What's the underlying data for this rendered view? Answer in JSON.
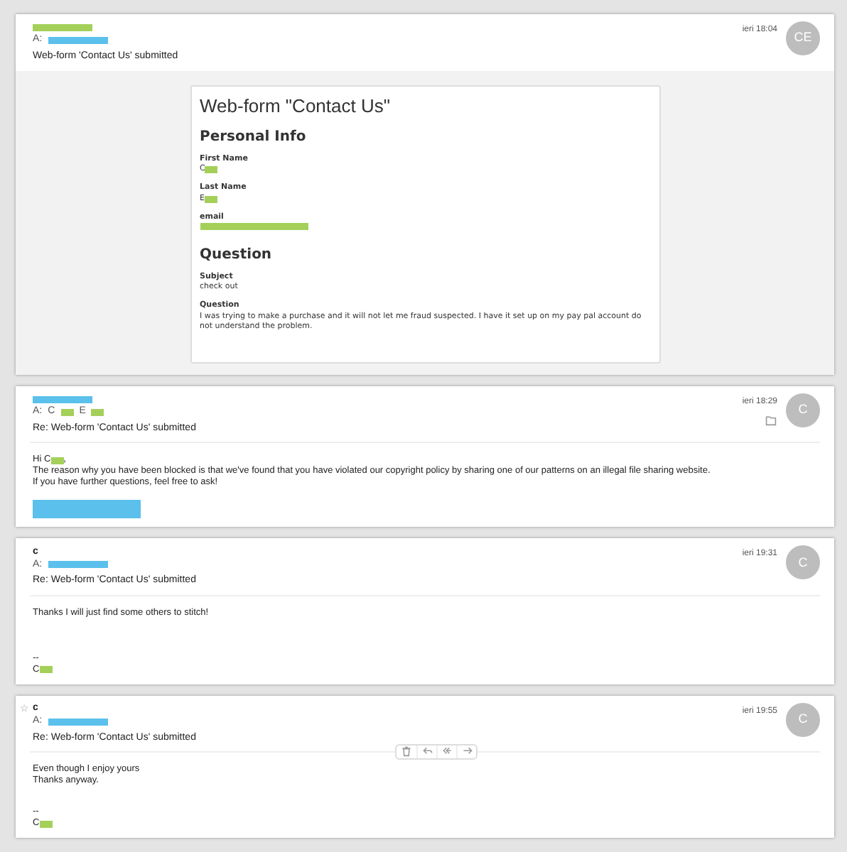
{
  "messages": [
    {
      "sender": [
        {
          "kind": "redaction",
          "color": "#a4d05a"
        }
      ],
      "to": [
        {
          "kind": "text",
          "text": "A:"
        },
        {
          "kind": "redaction",
          "color": "#5bc0eb"
        }
      ],
      "subject": "Web-form 'Contact Us' submitted",
      "time": "ieri 18:04",
      "avatar": "CE",
      "folder": false,
      "toolbar": false,
      "body": {
        "kind": "form",
        "title": "Web-form \"Contact Us\"",
        "sections": [
          {
            "heading": "Personal Info",
            "fields": [
              {
                "label": "First Name",
                "value": [
                  {
                    "kind": "text",
                    "text": "C"
                  },
                  {
                    "kind": "redaction",
                    "color": "#a4d05a"
                  }
                ]
              },
              {
                "label": "Last Name",
                "value": [
                  {
                    "kind": "text",
                    "text": "E"
                  },
                  {
                    "kind": "redaction",
                    "color": "#a4d05a"
                  }
                ]
              },
              {
                "label": "email",
                "value": [
                  {
                    "kind": "redaction",
                    "color": "#a4d05a"
                  }
                ]
              }
            ]
          },
          {
            "heading": "Question",
            "fields": [
              {
                "label": "Subject",
                "value": [
                  {
                    "kind": "text",
                    "text": "check out"
                  }
                ]
              },
              {
                "label": "Question",
                "value": [
                  {
                    "kind": "text",
                    "text": "I was trying to make a purchase and it will not let me fraud suspected. I have it set up on my pay pal account do not understand the problem."
                  }
                ]
              }
            ]
          }
        ]
      }
    },
    {
      "sender": [
        {
          "kind": "redaction",
          "color": "#5bc0eb"
        }
      ],
      "to": [
        {
          "kind": "text",
          "text": "A:"
        },
        {
          "kind": "text",
          "text": "C"
        },
        {
          "kind": "redaction",
          "color": "#a4d05a"
        },
        {
          "kind": "text",
          "text": "E"
        },
        {
          "kind": "redaction",
          "color": "#a4d05a"
        }
      ],
      "subject": "Re: Web-form 'Contact Us' submitted",
      "time": "ieri 18:29",
      "avatar": "C",
      "folder": true,
      "toolbar": false,
      "body": {
        "kind": "text",
        "lines": [
          [
            {
              "kind": "text",
              "text": "Hi C"
            },
            {
              "kind": "redaction",
              "color": "#a4d05a"
            },
            {
              "kind": "text",
              "text": ","
            }
          ],
          [
            {
              "kind": "text",
              "text": "The reason why you have been blocked is that we've found that you have violated our copyright policy by sharing one of our patterns on an illegal file sharing website."
            }
          ],
          [
            {
              "kind": "text",
              "text": "If you have further questions, feel free to ask!"
            }
          ]
        ],
        "signature": [
          [
            {
              "kind": "redaction",
              "color": "#5bc0eb"
            }
          ]
        ]
      }
    },
    {
      "sender": [
        {
          "kind": "text",
          "text": "c"
        }
      ],
      "to": [
        {
          "kind": "text",
          "text": "A:"
        },
        {
          "kind": "redaction",
          "color": "#5bc0eb"
        }
      ],
      "subject": "Re: Web-form 'Contact Us' submitted",
      "time": "ieri 19:31",
      "avatar": "C",
      "folder": false,
      "toolbar": false,
      "body": {
        "kind": "text",
        "lines": [
          [
            {
              "kind": "text",
              "text": "Thanks I will just find some others to stitch!"
            }
          ]
        ],
        "signature": [
          [
            {
              "kind": "text",
              "text": "--"
            }
          ],
          [
            {
              "kind": "text",
              "text": "C"
            },
            {
              "kind": "redaction",
              "color": "#a4d05a"
            }
          ]
        ]
      }
    },
    {
      "star": "☆",
      "sender": [
        {
          "kind": "text",
          "text": "c"
        }
      ],
      "to": [
        {
          "kind": "text",
          "text": "A:"
        },
        {
          "kind": "redaction",
          "color": "#5bc0eb"
        }
      ],
      "subject": "Re: Web-form 'Contact Us' submitted",
      "time": "ieri 19:55",
      "avatar": "C",
      "folder": false,
      "toolbar": true,
      "body": {
        "kind": "text",
        "lines": [
          [
            {
              "kind": "text",
              "text": "Even though I enjoy yours"
            }
          ],
          [
            {
              "kind": "text",
              "text": "Thanks anyway."
            }
          ]
        ],
        "signature": [
          [
            {
              "kind": "text",
              "text": "--"
            }
          ],
          [
            {
              "kind": "text",
              "text": "C"
            },
            {
              "kind": "redaction",
              "color": "#a4d05a"
            }
          ]
        ]
      }
    }
  ]
}
